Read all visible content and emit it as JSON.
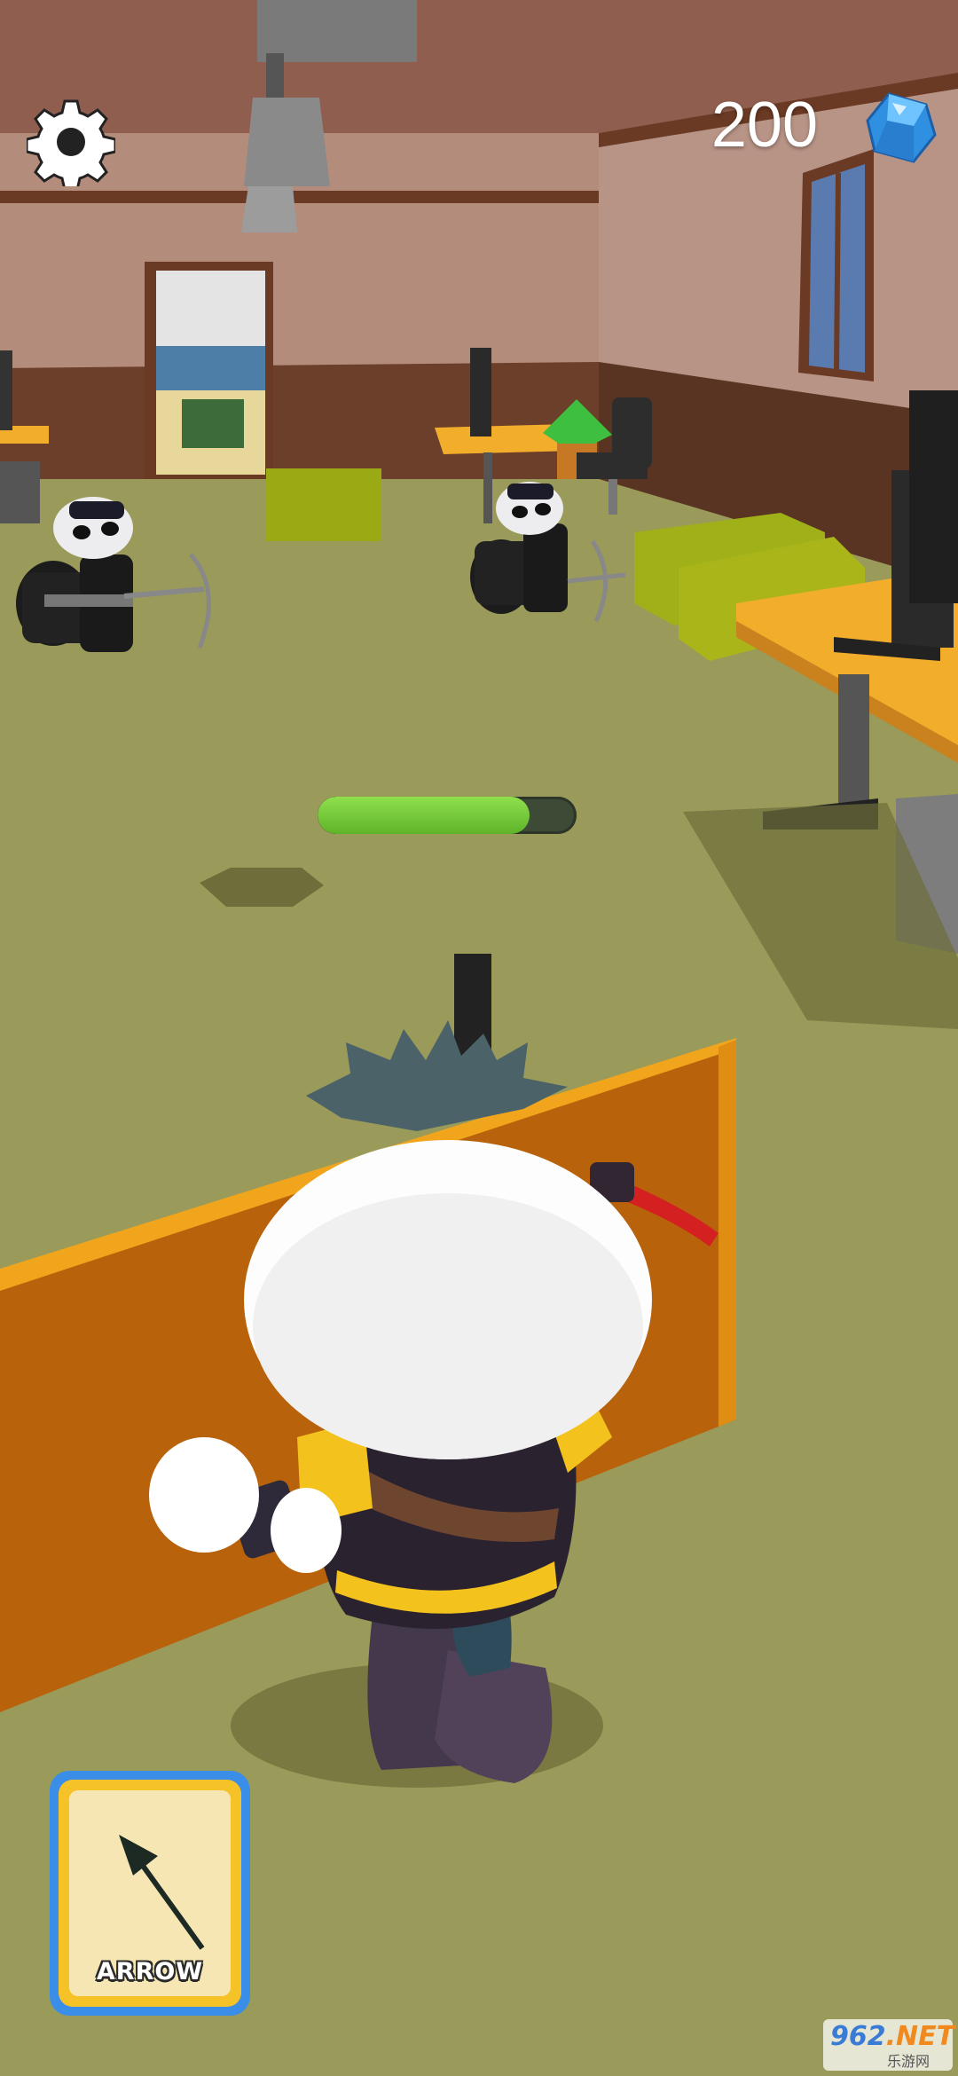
{
  "hud": {
    "settings_icon": "gear-icon",
    "gems": "200",
    "gem_icon": "blue-gem-icon",
    "health_percent": 82
  },
  "ability_card": {
    "label": "ARROW",
    "icon": "arrow-icon"
  },
  "watermark": {
    "brand_a": "962",
    "brand_b": ".NET",
    "subtitle": "乐游网"
  },
  "colors": {
    "floor": "#9a9a5a",
    "wall": "#b08c7a",
    "health": "#6cc33a",
    "card_border": "#3a8ee8",
    "card_gold": "#f5c328"
  }
}
